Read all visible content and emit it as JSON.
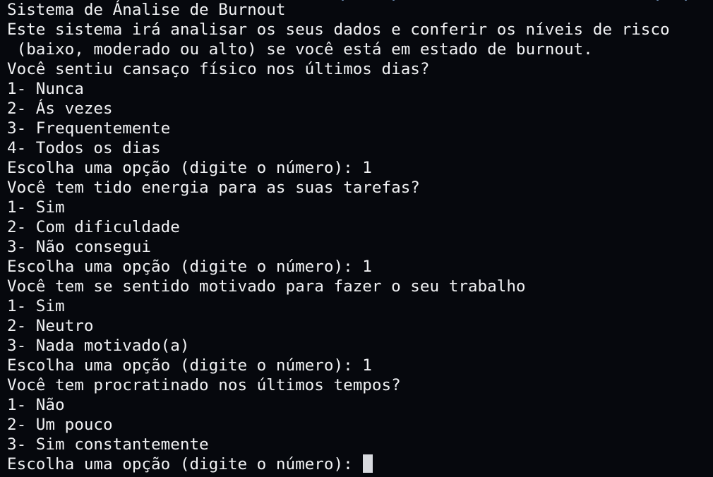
{
  "terminal": {
    "lines": [
      "Sistema de Ánalise de Burnout",
      "Este sistema irá analisar os seus dados e conferir os níveis de risco",
      " (baixo, moderado ou alto) se você está em estado de burnout.",
      "Você sentiu cansaço físico nos últimos dias?",
      "1- Nunca",
      "2- Ás vezes",
      "3- Frequentemente",
      "4- Todos os dias",
      "Escolha uma opção (digite o número): 1",
      "Você tem tido energia para as suas tarefas?",
      "1- Sim",
      "2- Com dificuldade",
      "3- Não consegui",
      "Escolha uma opção (digite o número): 1",
      "Você tem se sentido motivado para fazer o seu trabalho",
      "1- Sim",
      "2- Neutro",
      "3- Nada motivado(a)",
      "Escolha uma opção (digite o número): 1",
      "Você tem procratinado nos últimos tempos?",
      "1- Não",
      "2- Um pouco",
      "3- Sim constantemente"
    ],
    "prompt": "Escolha uma opção (digite o número): ",
    "background_color": "#06080d",
    "text_color": "#f0f1f3",
    "cursor_color": "#d8dadf"
  }
}
